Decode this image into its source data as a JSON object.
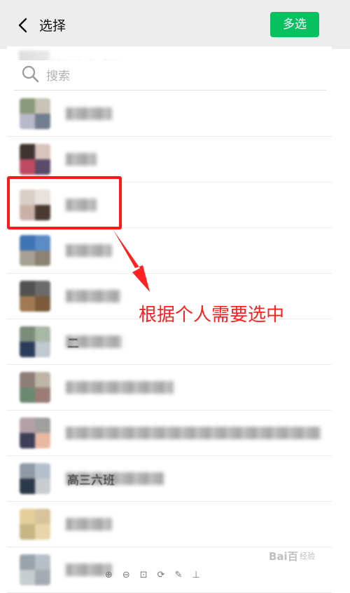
{
  "header": {
    "title": "选择",
    "multi_select_label": "多选"
  },
  "search": {
    "placeholder": "搜索"
  },
  "ghost_text": "浙江的亲戚群",
  "rows": [
    {
      "name_blur_width": 66,
      "avatar": [
        "#8a9a78",
        "#c9c2b6",
        "#b8b8c8",
        "#6f7f8f"
      ]
    },
    {
      "name_blur_width": 44,
      "avatar": [
        "#3f3432",
        "#d9c4bb",
        "#c04a62",
        "#5a4a6a"
      ]
    },
    {
      "name_blur_width": 44,
      "avatar": [
        "#d8cfc7",
        "#e8e1dc",
        "#c9b1a6",
        "#4a3a32"
      ]
    },
    {
      "name_blur_width": 66,
      "avatar": [
        "#3f73b3",
        "#5a8bc4",
        "#a7a193",
        "#8c8271"
      ]
    },
    {
      "name_blur_width": 78,
      "avatar": [
        "#515151",
        "#6b6b6b",
        "#a07a50",
        "#7b5b3b"
      ]
    },
    {
      "name_blur_width": 80,
      "avatar": [
        "#7b8b7a",
        "#a8b8a5",
        "#2a3c5a",
        "#c0c8d0"
      ],
      "name_hint": "二"
    },
    {
      "name_blur_width": 154,
      "avatar": [
        "#8e7d79",
        "#bdb5a6",
        "#6a8a6f",
        "#9a7c74"
      ]
    },
    {
      "name_blur_width": 364,
      "avatar": [
        "#b3a0a7",
        "#9fa09e",
        "#3d3f58",
        "#e9b8a2"
      ]
    },
    {
      "name_blur_width": 140,
      "avatar": [
        "#8f9aa6",
        "#b4c0cc",
        "#2b3a4a",
        "#c9ccd0"
      ],
      "name_hint": "高三六班"
    },
    {
      "name_blur_width": 66,
      "avatar": [
        "#e4cf9a",
        "#d7c49c",
        "#c8b584",
        "#e8d6aa"
      ]
    },
    {
      "name_blur_width": 66,
      "avatar": [
        "#9aa3ab",
        "#b7c0c6",
        "#c8cdd0",
        "#a5abb2"
      ]
    }
  ],
  "annotation": {
    "text": "根据个人需要选中",
    "color": "#ff2020"
  },
  "watermark": {
    "text": "Bai百",
    "sub": "经验"
  },
  "bottom_icons": "⊕⊖⊡⟳✎⊥",
  "colors": {
    "accent_green": "#07c160",
    "highlight_red": "#ff1a1a",
    "header_bg": "#ededed"
  },
  "icons": {
    "back": "chevron-left-icon",
    "search": "search-icon"
  }
}
